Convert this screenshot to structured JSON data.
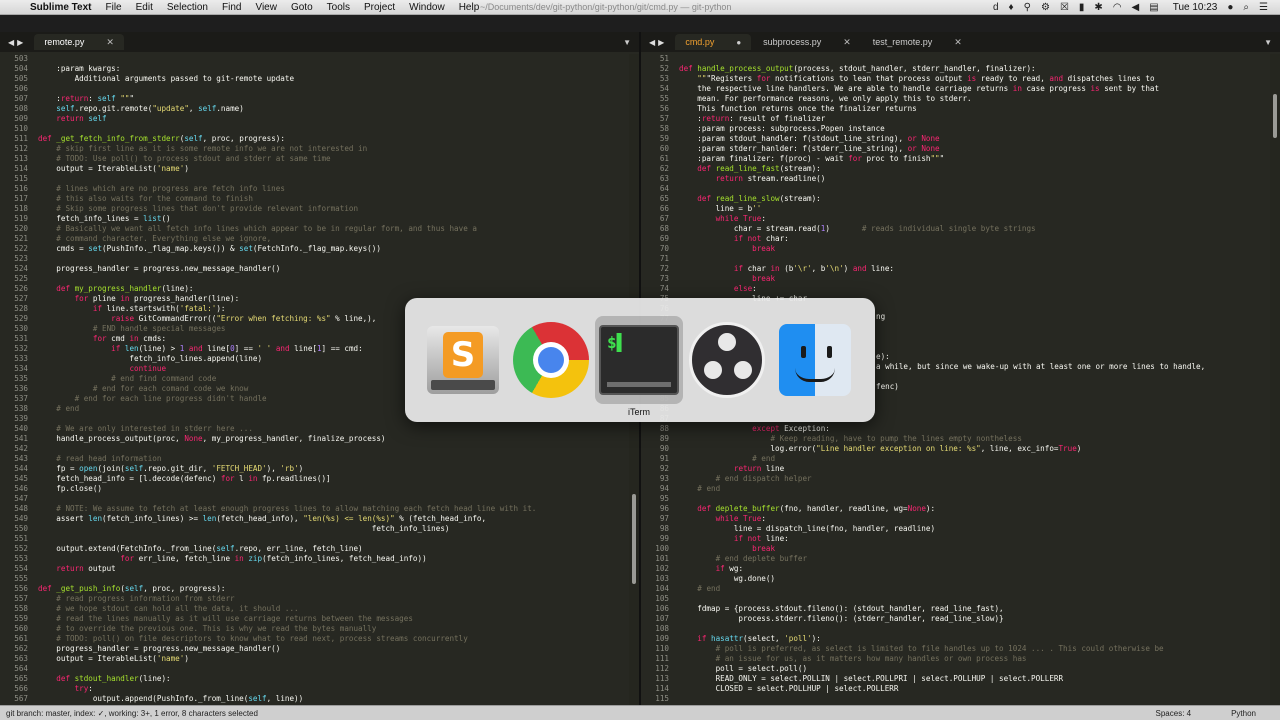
{
  "menubar": {
    "app_name": "Sublime Text",
    "menus": [
      "File",
      "Edit",
      "Selection",
      "Find",
      "View",
      "Goto",
      "Tools",
      "Project",
      "Window",
      "Help"
    ],
    "window_title": "~/Documents/dev/git-python/git-python/git/cmd.py — git-python",
    "clock": "Tue 10:23"
  },
  "left_pane": {
    "tabs": [
      {
        "label": "remote.py",
        "active": true
      }
    ],
    "line_start": 503,
    "lines": [
      "",
      "    :param kwargs:",
      "        Additional arguments passed to git-remote update",
      "",
      "    :return: self \"\"\"",
      "    self.repo.git.remote(\"update\", self.name)",
      "    return self",
      "",
      "def _get_fetch_info_from_stderr(self, proc, progress):",
      "    # skip first line as it is some remote info we are not interested in",
      "    # TODO: Use poll() to process stdout and stderr at same time",
      "    output = IterableList('name')",
      "",
      "    # lines which are no progress are fetch info lines",
      "    # this also waits for the command to finish",
      "    # Skip some progress lines that don't provide relevant information",
      "    fetch_info_lines = list()",
      "    # Basically we want all fetch info lines which appear to be in regular form, and thus have a",
      "    # command character. Everything else we ignore,",
      "    cmds = set(PushInfo._flag_map.keys()) & set(FetchInfo._flag_map.keys())",
      "",
      "    progress_handler = progress.new_message_handler()",
      "",
      "    def my_progress_handler(line):",
      "        for pline in progress_handler(line):",
      "            if line.startswith('fatal:'):",
      "                raise GitCommandError((\"Error when fetching: %s\" % line,),",
      "            # END handle special messages",
      "            for cmd in cmds:",
      "                if len(line) > 1 and line[0] == ' ' and line[1] == cmd:",
      "                    fetch_info_lines.append(line)",
      "                    continue",
      "                # end find command code",
      "            # end for each comand code we know",
      "        # end for each line progress didn't handle",
      "    # end",
      "",
      "    # We are only interested in stderr here ...",
      "    handle_process_output(proc, None, my_progress_handler, finalize_process)",
      "",
      "    # read head information",
      "    fp = open(join(self.repo.git_dir, 'FETCH_HEAD'), 'rb')",
      "    fetch_head_info = [l.decode(defenc) for l in fp.readlines()]",
      "    fp.close()",
      "",
      "    # NOTE: We assume to fetch at least enough progress lines to allow matching each fetch head line with it.",
      "    assert len(fetch_info_lines) >= len(fetch_head_info), \"len(%s) <= len(%s)\" % (fetch_head_info,",
      "                                                                         fetch_info_lines)",
      "",
      "    output.extend(FetchInfo._from_line(self.repo, err_line, fetch_line)",
      "                  for err_line, fetch_line in zip(fetch_info_lines, fetch_head_info))",
      "    return output",
      "",
      "def _get_push_info(self, proc, progress):",
      "    # read progress information from stderr",
      "    # we hope stdout can hold all the data, it should ...",
      "    # read the lines manually as it will use carriage returns between the messages",
      "    # to override the previous one. This is why we read the bytes manually",
      "    # TODO: poll() on file descriptors to know what to read next, process streams concurrently",
      "    progress_handler = progress.new_message_handler()",
      "    output = IterableList('name')",
      "",
      "    def stdout_handler(line):",
      "        try:",
      "            output.append(PushInfo._from_line(self, line))"
    ]
  },
  "right_pane": {
    "tabs": [
      {
        "label": "cmd.py",
        "active": true,
        "modified": true
      },
      {
        "label": "subprocess.py",
        "active": false
      },
      {
        "label": "test_remote.py",
        "active": false
      }
    ],
    "line_start": 51,
    "lines": [
      "",
      "def handle_process_output(process, stdout_handler, stderr_handler, finalizer):",
      "    \"\"\"Registers for notifications to lean that process output is ready to read, and dispatches lines to",
      "    the respective line handlers. We are able to handle carriage returns in case progress is sent by that",
      "    mean. For performance reasons, we only apply this to stderr.",
      "    This function returns once the finalizer returns",
      "    :return: result of finalizer",
      "    :param process: subprocess.Popen instance",
      "    :param stdout_handler: f(stdout_line_string), or None",
      "    :param stderr_hanlder: f(stderr_line_string), or None",
      "    :param finalizer: f(proc) - wait for proc to finish\"\"\"",
      "    def read_line_fast(stream):",
      "        return stream.readline()",
      "",
      "    def read_line_slow(stream):",
      "        line = b''",
      "        while True:",
      "            char = stream.read(1)       # reads individual single byte strings",
      "            if not char:",
      "                break",
      "",
      "            if char in (b'\\r', b'\\n') and line:",
      "                break",
      "            else:",
      "                line += char",
      "",
      "",
      "",
      "",
      "",
      "",
      "",
      "",
      "",
      "",
      "",
      "",
      "                except Exception:",
      "                    # Keep reading, have to pump the lines empty nontheless",
      "                    log.error(\"Line handler exception on line: %s\", line, exc_info=True)",
      "                # end",
      "            return line",
      "        # end dispatch helper",
      "    # end",
      "",
      "    def deplete_buffer(fno, handler, readline, wg=None):",
      "        while True:",
      "            line = dispatch_line(fno, handler, readline)",
      "            if not line:",
      "                break",
      "        # end deplete buffer",
      "        if wg:",
      "            wg.done()",
      "    # end",
      "",
      "    fdmap = {process.stdout.fileno(): (stdout_handler, read_line_fast),",
      "             process.stderr.fileno(): (stderr_handler, read_line_slow)}",
      "",
      "    if hasattr(select, 'poll'):",
      "        # poll is preferred, as select is limited to file handles up to 1024 ... . This could otherwise be",
      "        # an issue for us, as it matters how many handles or own process has",
      "        poll = select.poll()",
      "        READ_ONLY = select.POLLIN | select.POLLPRI | select.POLLHUP | select.POLLERR",
      "        CLOSED = select.POLLHUP | select.POLLERR",
      ""
    ],
    "peek_fragments": [
      "ng",
      "e):",
      "a while, but since we wake-up with at least one or more lines to handle,",
      "fenc)"
    ]
  },
  "statusbar": {
    "left": "git branch: master, index: ✓, working: 3+, 1 error, 8 characters selected",
    "spaces": "Spaces: 4",
    "syntax": "Python"
  },
  "app_switcher": {
    "apps": [
      {
        "name": "Sublime Text",
        "icon": "sublime-text-icon"
      },
      {
        "name": "Google Chrome",
        "icon": "chrome-icon"
      },
      {
        "name": "iTerm",
        "icon": "iterm-icon",
        "selected": true
      },
      {
        "name": "OBS",
        "icon": "obs-icon"
      },
      {
        "name": "Finder",
        "icon": "finder-icon"
      }
    ],
    "selected_label": "iTerm"
  }
}
